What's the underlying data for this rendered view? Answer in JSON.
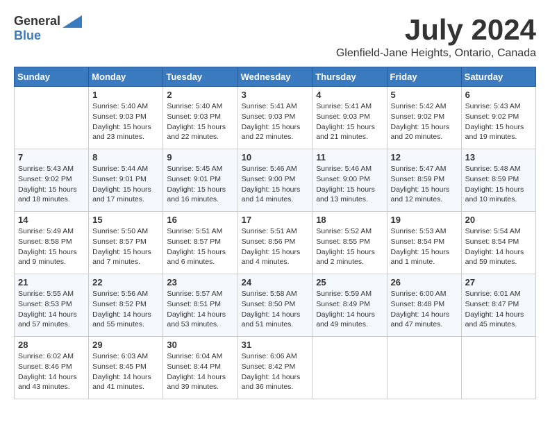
{
  "header": {
    "logo_general": "General",
    "logo_blue": "Blue",
    "month_title": "July 2024",
    "location": "Glenfield-Jane Heights, Ontario, Canada"
  },
  "days_of_week": [
    "Sunday",
    "Monday",
    "Tuesday",
    "Wednesday",
    "Thursday",
    "Friday",
    "Saturday"
  ],
  "weeks": [
    [
      {
        "day": "",
        "info": ""
      },
      {
        "day": "1",
        "info": "Sunrise: 5:40 AM\nSunset: 9:03 PM\nDaylight: 15 hours\nand 23 minutes."
      },
      {
        "day": "2",
        "info": "Sunrise: 5:40 AM\nSunset: 9:03 PM\nDaylight: 15 hours\nand 22 minutes."
      },
      {
        "day": "3",
        "info": "Sunrise: 5:41 AM\nSunset: 9:03 PM\nDaylight: 15 hours\nand 22 minutes."
      },
      {
        "day": "4",
        "info": "Sunrise: 5:41 AM\nSunset: 9:03 PM\nDaylight: 15 hours\nand 21 minutes."
      },
      {
        "day": "5",
        "info": "Sunrise: 5:42 AM\nSunset: 9:02 PM\nDaylight: 15 hours\nand 20 minutes."
      },
      {
        "day": "6",
        "info": "Sunrise: 5:43 AM\nSunset: 9:02 PM\nDaylight: 15 hours\nand 19 minutes."
      }
    ],
    [
      {
        "day": "7",
        "info": "Sunrise: 5:43 AM\nSunset: 9:02 PM\nDaylight: 15 hours\nand 18 minutes."
      },
      {
        "day": "8",
        "info": "Sunrise: 5:44 AM\nSunset: 9:01 PM\nDaylight: 15 hours\nand 17 minutes."
      },
      {
        "day": "9",
        "info": "Sunrise: 5:45 AM\nSunset: 9:01 PM\nDaylight: 15 hours\nand 16 minutes."
      },
      {
        "day": "10",
        "info": "Sunrise: 5:46 AM\nSunset: 9:00 PM\nDaylight: 15 hours\nand 14 minutes."
      },
      {
        "day": "11",
        "info": "Sunrise: 5:46 AM\nSunset: 9:00 PM\nDaylight: 15 hours\nand 13 minutes."
      },
      {
        "day": "12",
        "info": "Sunrise: 5:47 AM\nSunset: 8:59 PM\nDaylight: 15 hours\nand 12 minutes."
      },
      {
        "day": "13",
        "info": "Sunrise: 5:48 AM\nSunset: 8:59 PM\nDaylight: 15 hours\nand 10 minutes."
      }
    ],
    [
      {
        "day": "14",
        "info": "Sunrise: 5:49 AM\nSunset: 8:58 PM\nDaylight: 15 hours\nand 9 minutes."
      },
      {
        "day": "15",
        "info": "Sunrise: 5:50 AM\nSunset: 8:57 PM\nDaylight: 15 hours\nand 7 minutes."
      },
      {
        "day": "16",
        "info": "Sunrise: 5:51 AM\nSunset: 8:57 PM\nDaylight: 15 hours\nand 6 minutes."
      },
      {
        "day": "17",
        "info": "Sunrise: 5:51 AM\nSunset: 8:56 PM\nDaylight: 15 hours\nand 4 minutes."
      },
      {
        "day": "18",
        "info": "Sunrise: 5:52 AM\nSunset: 8:55 PM\nDaylight: 15 hours\nand 2 minutes."
      },
      {
        "day": "19",
        "info": "Sunrise: 5:53 AM\nSunset: 8:54 PM\nDaylight: 15 hours\nand 1 minute."
      },
      {
        "day": "20",
        "info": "Sunrise: 5:54 AM\nSunset: 8:54 PM\nDaylight: 14 hours\nand 59 minutes."
      }
    ],
    [
      {
        "day": "21",
        "info": "Sunrise: 5:55 AM\nSunset: 8:53 PM\nDaylight: 14 hours\nand 57 minutes."
      },
      {
        "day": "22",
        "info": "Sunrise: 5:56 AM\nSunset: 8:52 PM\nDaylight: 14 hours\nand 55 minutes."
      },
      {
        "day": "23",
        "info": "Sunrise: 5:57 AM\nSunset: 8:51 PM\nDaylight: 14 hours\nand 53 minutes."
      },
      {
        "day": "24",
        "info": "Sunrise: 5:58 AM\nSunset: 8:50 PM\nDaylight: 14 hours\nand 51 minutes."
      },
      {
        "day": "25",
        "info": "Sunrise: 5:59 AM\nSunset: 8:49 PM\nDaylight: 14 hours\nand 49 minutes."
      },
      {
        "day": "26",
        "info": "Sunrise: 6:00 AM\nSunset: 8:48 PM\nDaylight: 14 hours\nand 47 minutes."
      },
      {
        "day": "27",
        "info": "Sunrise: 6:01 AM\nSunset: 8:47 PM\nDaylight: 14 hours\nand 45 minutes."
      }
    ],
    [
      {
        "day": "28",
        "info": "Sunrise: 6:02 AM\nSunset: 8:46 PM\nDaylight: 14 hours\nand 43 minutes."
      },
      {
        "day": "29",
        "info": "Sunrise: 6:03 AM\nSunset: 8:45 PM\nDaylight: 14 hours\nand 41 minutes."
      },
      {
        "day": "30",
        "info": "Sunrise: 6:04 AM\nSunset: 8:44 PM\nDaylight: 14 hours\nand 39 minutes."
      },
      {
        "day": "31",
        "info": "Sunrise: 6:06 AM\nSunset: 8:42 PM\nDaylight: 14 hours\nand 36 minutes."
      },
      {
        "day": "",
        "info": ""
      },
      {
        "day": "",
        "info": ""
      },
      {
        "day": "",
        "info": ""
      }
    ]
  ]
}
